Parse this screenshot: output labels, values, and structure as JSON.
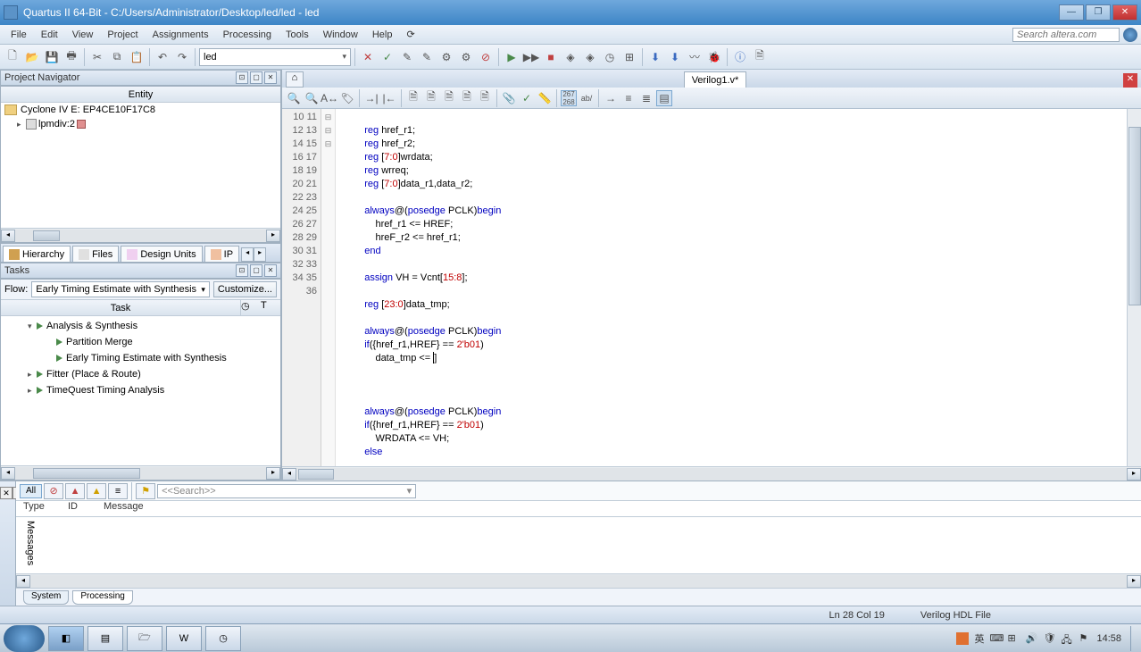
{
  "window": {
    "title": "Quartus II 64-Bit - C:/Users/Administrator/Desktop/led/led - led"
  },
  "menu": [
    "File",
    "Edit",
    "View",
    "Project",
    "Assignments",
    "Processing",
    "Tools",
    "Window",
    "Help"
  ],
  "search_placeholder": "Search altera.com",
  "project_selector": "led",
  "nav": {
    "title": "Project Navigator",
    "entity_col": "Entity",
    "device": "Cyclone IV E: EP4CE10F17C8",
    "instance": "lpmdiv:2",
    "tabs": [
      "Hierarchy",
      "Files",
      "Design Units",
      "IP"
    ]
  },
  "tasks": {
    "title": "Tasks",
    "flow_label": "Flow:",
    "flow_value": "Early Timing Estimate with Synthesis",
    "customize": "Customize...",
    "cols": [
      "Task",
      "",
      "T"
    ],
    "tree": [
      {
        "level": 1,
        "label": "Analysis & Synthesis",
        "expand": "▾"
      },
      {
        "level": 2,
        "label": "Partition Merge"
      },
      {
        "level": 2,
        "label": "Early Timing Estimate with Synthesis"
      },
      {
        "level": 1,
        "label": "Fitter (Place & Route)",
        "expand": "▸"
      },
      {
        "level": 1,
        "label": "TimeQuest Timing Analysis",
        "expand": "▸"
      }
    ]
  },
  "editor": {
    "file_tab": "Verilog1.v*",
    "first_line_no": 10,
    "lines": [
      "",
      "    reg href_r1;",
      "    reg href_r2;",
      "    reg [7:0]wrdata;",
      "    reg wrreq;",
      "    reg [7:0]data_r1,data_r2;",
      "",
      "    always@(posedge PCLK)begin",
      "        href_r1 <= HREF;",
      "        hreF_r2 <= href_r1;",
      "    end",
      "",
      "    assign VH = Vcnt[15:8];",
      "",
      "    reg [23:0]data_tmp;",
      "",
      "    always@(posedge PCLK)begin",
      "    if({href_r1,HREF} == 2'b01)",
      "        data_tmp <= ",
      "",
      "",
      "",
      "    always@(posedge PCLK)begin",
      "    if({href_r1,HREF} == 2'b01)",
      "        WRDATA <= VH;",
      "    else",
      ""
    ],
    "folds": {
      "17": "⊟",
      "26": "⊟",
      "32": "⊟"
    }
  },
  "messages": {
    "side_label": "Messages",
    "all": "All",
    "search_placeholder": "<<Search>>",
    "cols": {
      "type": "Type",
      "id": "ID",
      "message": "Message"
    },
    "tabs": [
      "System",
      "Processing"
    ]
  },
  "status": {
    "pos": "Ln 28   Col 19",
    "mode": "Verilog HDL File"
  },
  "taskbar": {
    "time": "14:58"
  }
}
